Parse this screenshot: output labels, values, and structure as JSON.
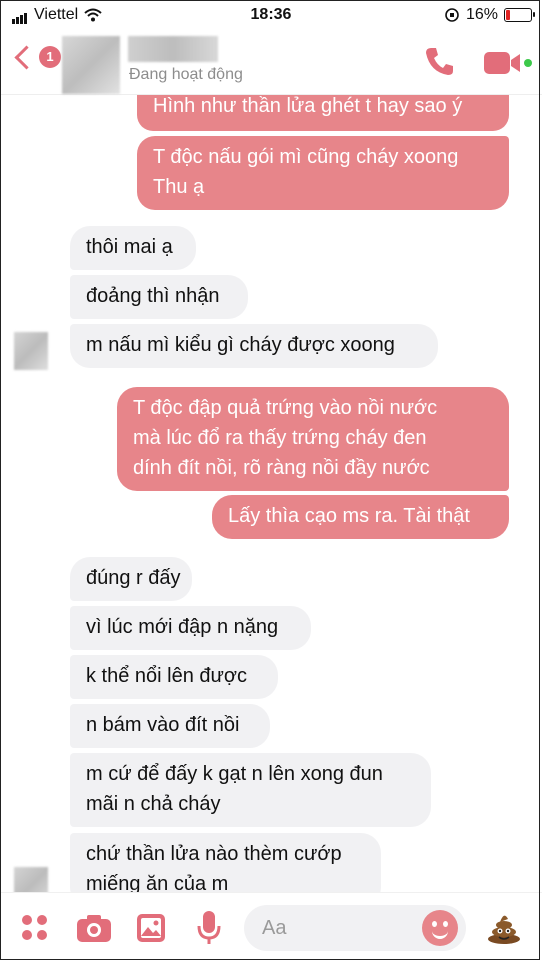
{
  "status_bar": {
    "carrier": "Viettel",
    "time": "18:36",
    "battery": "16%"
  },
  "header": {
    "unread_count": "1",
    "presence": "Đang hoạt động"
  },
  "messages": [
    {
      "text": "Hình như thần lửa ghét t hay sao ý"
    },
    {
      "text": "T độc nấu gói mì cũng cháy xoong\nThu ạ"
    },
    {
      "text": "thôi mai ạ"
    },
    {
      "text": "đoảng thì nhận"
    },
    {
      "text": "m nấu mì kiểu gì cháy được xoong"
    },
    {
      "text": "T độc đập quả trứng vào nồi nước\nmà lúc đổ ra thấy trứng cháy đen\ndính đít nồi, rõ ràng nồi đầy nước"
    },
    {
      "text": "Lấy thìa cạo ms ra. Tài thật"
    },
    {
      "text": "đúng r đấy"
    },
    {
      "text": "vì lúc mới đập n nặng"
    },
    {
      "text": "k thể nổi lên được"
    },
    {
      "text": "n bám vào đít nồi"
    },
    {
      "text": "m cứ để đấy k gạt n lên xong đun\nmãi n chả cháy"
    },
    {
      "text": "chứ thần lửa nào thèm cướp\nmiếng ăn của m"
    }
  ],
  "composer": {
    "placeholder": "Aa"
  },
  "icons": {
    "back": "chevron-left-icon",
    "phone": "phone-icon",
    "video": "video-icon",
    "apps": "apps-grid-icon",
    "camera": "camera-icon",
    "gallery": "image-icon",
    "mic": "microphone-icon",
    "emoji": "emoji-icon",
    "quick_reaction": "poop-emoji-icon"
  },
  "colors": {
    "accent": "#e26d7a",
    "outgoing_bubble": "#e7858a",
    "incoming_bubble": "#f1f1f3"
  }
}
